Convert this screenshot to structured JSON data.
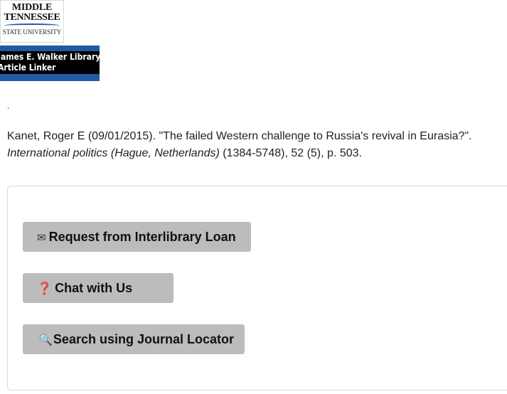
{
  "logo": {
    "line1": "MIDDLE",
    "line2": "TENNESSEE",
    "line3": "STATE UNIVERSITY"
  },
  "banner": {
    "line1": "James E. Walker Library",
    "line2": "Article Linker"
  },
  "dot": ".",
  "citation": {
    "authors_date_title": "Kanet, Roger E (09/01/2015). \"The failed Western challenge to Russia's revival in Eurasia?\".",
    "journal": "International politics (Hague, Netherlands)",
    "details": " (1384-5748), 52 (5), p. 503."
  },
  "actions": {
    "ill": {
      "icon": "envelope-icon",
      "label": "Request from Interlibrary Loan"
    },
    "chat": {
      "icon": "question-icon",
      "label": "Chat with Us"
    },
    "journal": {
      "icon": "magnifier-icon",
      "label": "Search using Journal Locator"
    }
  },
  "colors": {
    "brand_blue": "#1e5aa6",
    "banner_black": "#000000",
    "button_gray": "#bcbcbc",
    "question_red": "#d41f1f"
  }
}
